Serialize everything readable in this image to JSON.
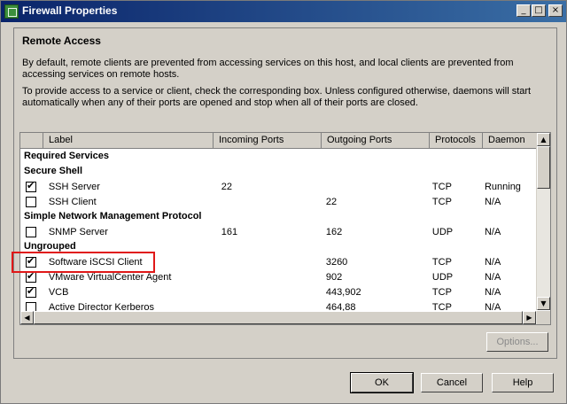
{
  "window": {
    "title": "Firewall Properties"
  },
  "titlebar_buttons": {
    "minimize": "_",
    "maximize": "□",
    "close": "×"
  },
  "section": {
    "title": "Remote Access",
    "desc1": "By default, remote clients are prevented from accessing services on this host, and local clients are prevented from accessing services on remote hosts.",
    "desc2": "To provide access to a service or client, check the corresponding box. Unless configured otherwise, daemons will start automatically when any of their ports are opened and stop when all of their ports are closed."
  },
  "table": {
    "columns": [
      "Label",
      "Incoming Ports",
      "Outgoing Ports",
      "Protocols",
      "Daemon"
    ],
    "groups": [
      {
        "title": "Required Services",
        "rows": []
      },
      {
        "title": "Secure Shell",
        "rows": [
          {
            "checked": true,
            "label": "SSH Server",
            "in": "22",
            "out": "",
            "proto": "TCP",
            "daemon": "Running"
          },
          {
            "checked": false,
            "label": "SSH Client",
            "in": "",
            "out": "22",
            "proto": "TCP",
            "daemon": "N/A"
          }
        ]
      },
      {
        "title": "Simple Network Management Protocol",
        "rows": [
          {
            "checked": false,
            "label": "SNMP Server",
            "in": "161",
            "out": "162",
            "proto": "UDP",
            "daemon": "N/A"
          }
        ]
      },
      {
        "title": "Ungrouped",
        "rows": [
          {
            "checked": true,
            "label": "Software iSCSI Client",
            "in": "",
            "out": "3260",
            "proto": "TCP",
            "daemon": "N/A"
          },
          {
            "checked": true,
            "label": "VMware VirtualCenter Agent",
            "in": "",
            "out": "902",
            "proto": "UDP",
            "daemon": "N/A"
          },
          {
            "checked": true,
            "label": "VCB",
            "in": "",
            "out": "443,902",
            "proto": "TCP",
            "daemon": "N/A"
          },
          {
            "checked": false,
            "label": "Active Director Kerberos",
            "in": "",
            "out": "464,88",
            "proto": "TCP",
            "daemon": "N/A"
          }
        ]
      }
    ]
  },
  "buttons": {
    "options": "Options...",
    "ok": "OK",
    "cancel": "Cancel",
    "help": "Help"
  },
  "colors": {
    "highlight": "#e01818",
    "titlebar": "#0a246a"
  }
}
